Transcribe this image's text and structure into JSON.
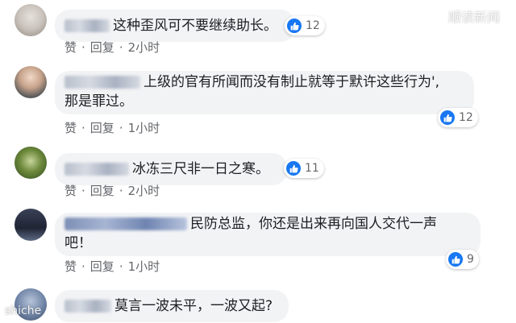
{
  "watermark_top": "顺读新闻",
  "watermark_bottom_left": "shiche",
  "comments": [
    {
      "author": "",
      "text": "这种歪风可不要继续助长。",
      "likes": "12",
      "actions": {
        "like": "赞",
        "reply": "回复",
        "time": "2小时"
      }
    },
    {
      "author": "",
      "text_line1": "上级的官有所闻而没有制止就等于默许这些行为',",
      "text_line2": "那是罪过。",
      "likes": "12",
      "actions": {
        "like": "赞",
        "reply": "回复",
        "time": "1小时"
      }
    },
    {
      "author": "",
      "text": "冰冻三尺非一日之寒。",
      "likes": "11",
      "actions": {
        "like": "赞",
        "reply": "回复",
        "time": "2小时"
      }
    },
    {
      "author": "",
      "text_line1": "民防总监，你还是出来再向国人交代一声",
      "text_line2": "吧！",
      "likes": "9",
      "actions": {
        "like": "赞",
        "reply": "回复",
        "time": "1小时"
      }
    },
    {
      "author": "",
      "text": "莫言一波未平，一波又起?"
    }
  ]
}
